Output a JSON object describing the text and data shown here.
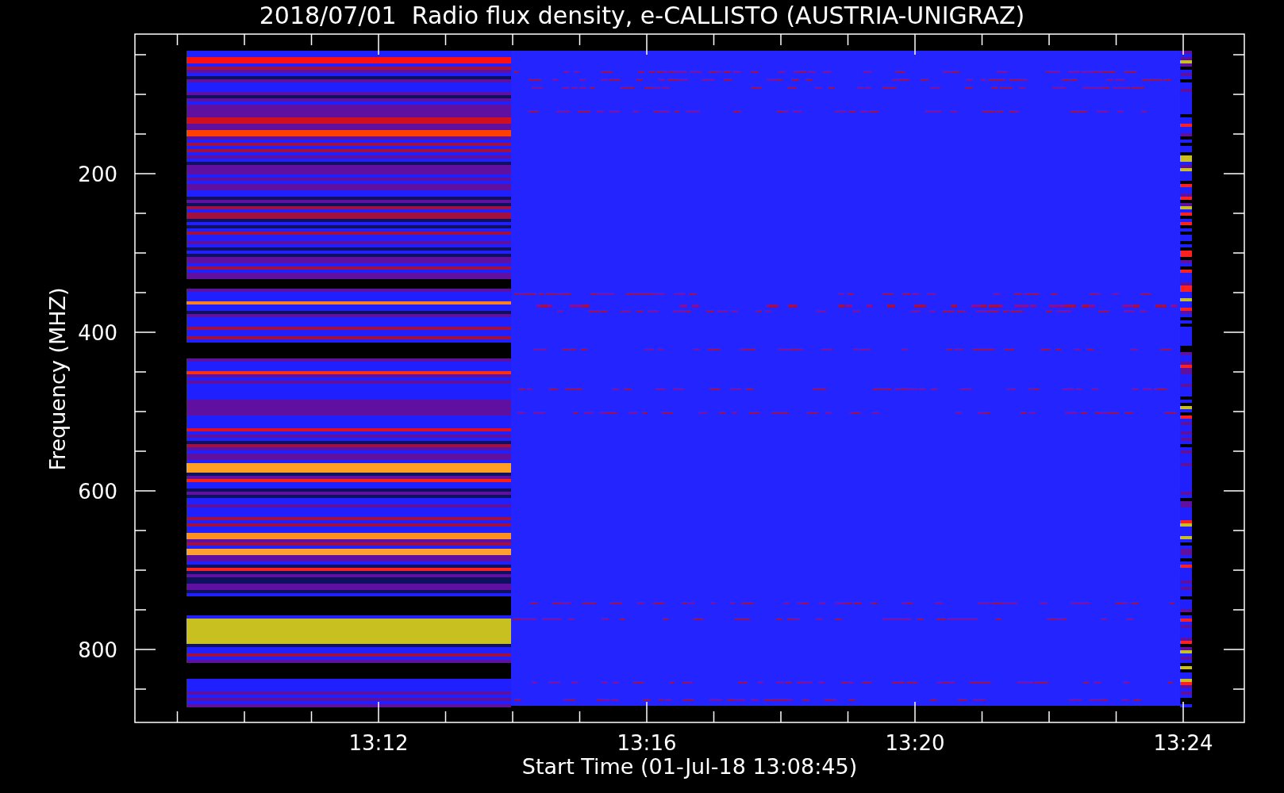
{
  "title": "2018/07/01  Radio flux density, e-CALLISTO (AUSTRIA-UNIGRAZ)",
  "xlabel": "Start Time (01-Jul-18 13:08:45)",
  "ylabel": "Frequency (MHZ)",
  "xticks": [
    "13:12",
    "13:16",
    "13:20",
    "13:24"
  ],
  "yticks": [
    "200",
    "400",
    "600",
    "800"
  ]
}
